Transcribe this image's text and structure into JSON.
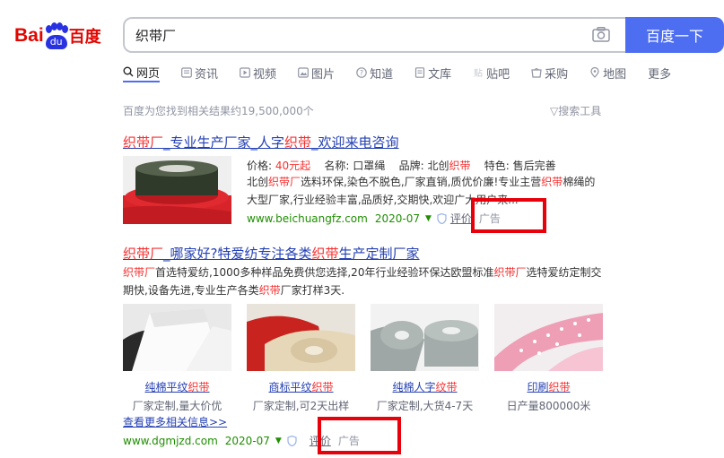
{
  "header": {
    "logo_bai": "Bai",
    "logo_du": "du",
    "logo_cn": "百度",
    "search_value": "织带厂",
    "search_button": "百度一下"
  },
  "tabs": [
    {
      "label": "网页",
      "icon": "search-icon"
    },
    {
      "label": "资讯",
      "icon": "news-icon"
    },
    {
      "label": "视频",
      "icon": "video-icon"
    },
    {
      "label": "图片",
      "icon": "image-icon"
    },
    {
      "label": "知道",
      "icon": "question-icon"
    },
    {
      "label": "文库",
      "icon": "document-icon"
    },
    {
      "label": "贴吧",
      "icon": "tieba-icon"
    },
    {
      "label": "采购",
      "icon": "purchase-icon"
    },
    {
      "label": "地图",
      "icon": "map-icon"
    },
    {
      "label": "更多",
      "icon": ""
    }
  ],
  "result_count": "百度为您找到相关结果约19,500,000个",
  "search_tools": "搜索工具",
  "result1": {
    "title_parts": [
      "织带厂",
      "_专业生产厂家_人字",
      "织带",
      "_欢迎来电咨询"
    ],
    "meta": {
      "price_label": "价格:",
      "price_value": "40元起",
      "name_label": "名称:",
      "name_value": "口罩绳",
      "brand_label": "品牌:",
      "brand_value_a": "北创",
      "brand_value_b": "织带",
      "feature_label": "特色:",
      "feature_value": "售后完善"
    },
    "desc_parts": [
      "北创",
      "织带厂",
      "选料环保,染色不脱色,厂家直销,质优价廉!专业主营",
      "织带",
      "棉绳的大型厂家,行业经验丰富,品质好,交期快,欢迎广大用户来..."
    ],
    "url": "www.beichuangfz.com",
    "date": "2020-07",
    "review": "评价",
    "ad": "广告"
  },
  "result2": {
    "title_parts": [
      "织带厂",
      "_哪家好?特爱纺专注各类",
      "织带",
      "生产定制厂家"
    ],
    "desc_parts": [
      "织带厂",
      "首选特爱纺,1000多种样品免费供您选择,20年行业经验环保达欧盟标准",
      "织带厂",
      "选特爱纺定制交期快,设备先进,专业生产各类",
      "织带",
      "厂家打样3天."
    ],
    "items": [
      {
        "label_a": "纯棉平纹",
        "label_b": "织带",
        "desc": "厂家定制,量大价优"
      },
      {
        "label_a": "商标平纹",
        "label_b": "织带",
        "desc": "厂家定制,可2天出样"
      },
      {
        "label_a": "纯棉人字",
        "label_b": "纹带",
        "desc": "厂家定制,大货4-7天"
      },
      {
        "label_a": "印刷",
        "label_b": "织带",
        "desc": "日产量800000米"
      }
    ],
    "more": "查看更多相关信息>>",
    "url": "www.dgmjzd.com",
    "date": "2020-07",
    "review": "评价",
    "ad": "广告"
  },
  "colors": {
    "brand_blue": "#4e6ef2",
    "link_blue": "#2440b3",
    "highlight_red": "#f73131",
    "url_green": "#1e8f00",
    "annotation_red": "#e8000b"
  }
}
